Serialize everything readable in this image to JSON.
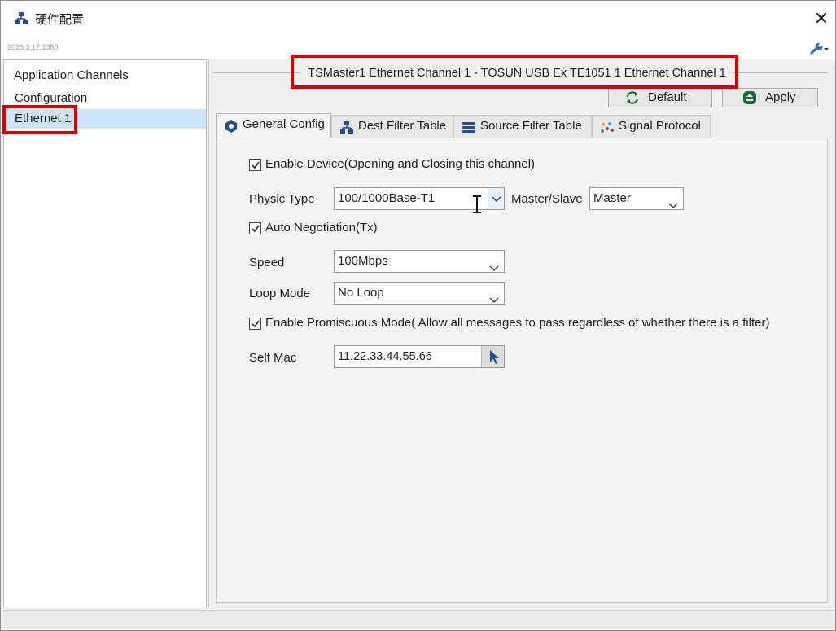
{
  "window": {
    "title": "硬件配置",
    "version": "2025.3.17.1350",
    "close_glyph": "✕"
  },
  "tree": {
    "items": [
      {
        "label": "Application Channels"
      },
      {
        "label": "Configuration"
      },
      {
        "label": "Ethernet 1",
        "selected": true
      }
    ]
  },
  "header": {
    "channel_title": "TSMaster1 Ethernet Channel 1 - TOSUN USB Ex TE1051 1 Ethernet Channel 1",
    "default_label": "Default",
    "apply_label": "Apply"
  },
  "tabs": [
    {
      "label": "General Config",
      "icon": "gear-hex-icon",
      "active": true
    },
    {
      "label": "Dest Filter Table",
      "icon": "network-icon"
    },
    {
      "label": "Source Filter Table",
      "icon": "stack-icon"
    },
    {
      "label": "Signal Protocol",
      "icon": "dots-icon"
    }
  ],
  "general": {
    "enable_device_label": "Enable Device(Opening and Closing this channel)",
    "enable_device_checked": true,
    "physic_type_label": "Physic Type",
    "physic_type_value": "100/1000Base-T1",
    "master_slave_label": "Master/Slave",
    "master_slave_value": "Master",
    "auto_negotiation_label": "Auto Negotiation(Tx)",
    "auto_negotiation_checked": true,
    "speed_label": "Speed",
    "speed_value": "100Mbps",
    "loop_mode_label": "Loop Mode",
    "loop_mode_value": "No Loop",
    "promiscuous_label": "Enable Promiscuous Mode( Allow all messages to pass regardless of whether there is a filter)",
    "promiscuous_checked": true,
    "self_mac_label": "Self Mac",
    "self_mac_value": "11.22.33.44.55.66"
  },
  "colors": {
    "highlight": "#e00000",
    "selection": "#cce4f7",
    "accent_green": "#1e6b3a",
    "accent_blue": "#1f4e9c"
  }
}
